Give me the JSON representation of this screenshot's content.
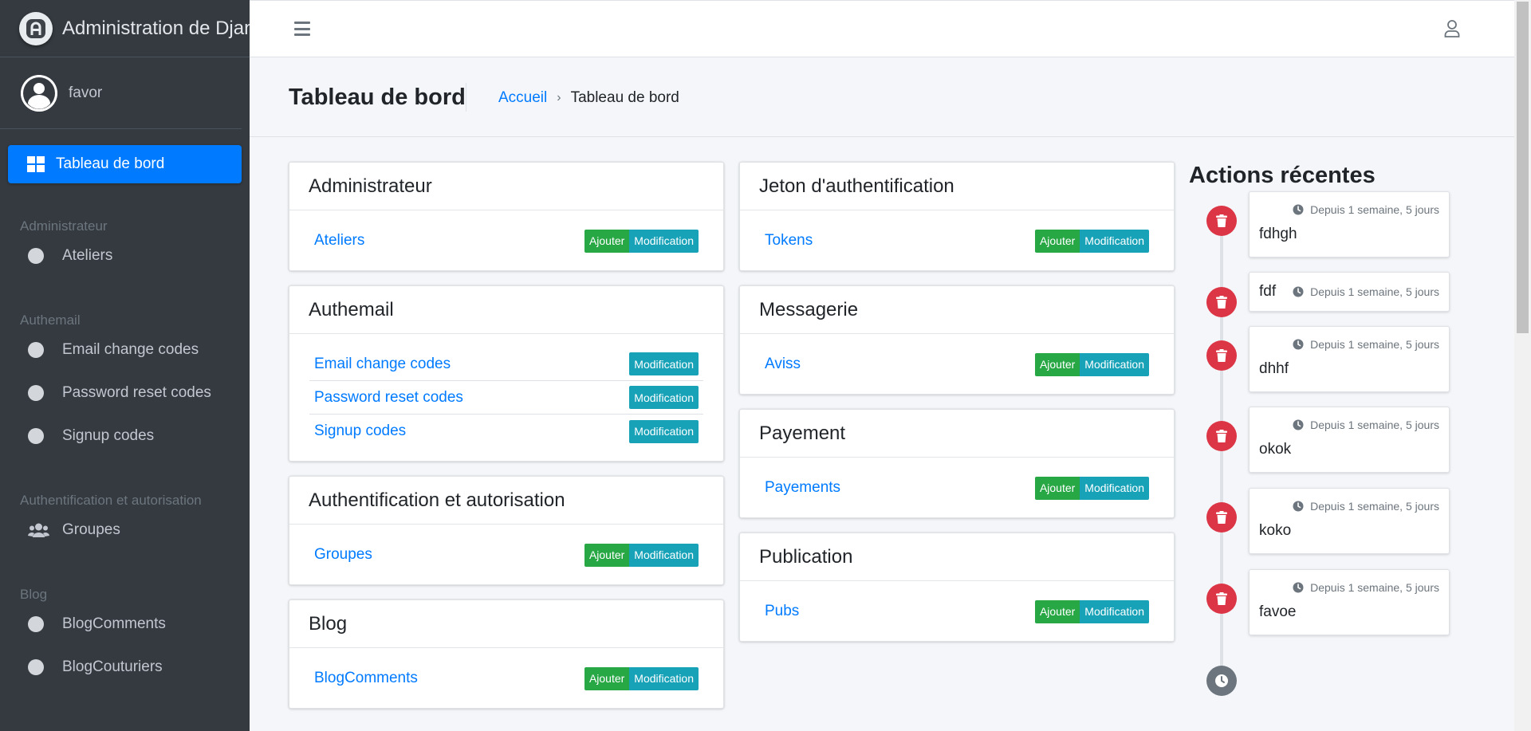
{
  "brand": {
    "title": "Administration de Django"
  },
  "user": {
    "name": "favor"
  },
  "sidebar": {
    "active": "Tableau de bord",
    "groups": [
      {
        "header": "Administrateur",
        "items": [
          "Ateliers"
        ]
      },
      {
        "header": "Authemail",
        "items": [
          "Email change codes",
          "Password reset codes",
          "Signup codes"
        ]
      },
      {
        "header": "Authentification et autorisation",
        "items": [
          "Groupes"
        ]
      },
      {
        "header": "Blog",
        "items": [
          "BlogComments",
          "BlogCouturiers"
        ]
      }
    ]
  },
  "header": {
    "title": "Tableau de bord",
    "breadcrumb_home": "Accueil",
    "breadcrumb_current": "Tableau de bord"
  },
  "labels": {
    "add": "Ajouter",
    "change": "Modification"
  },
  "apps_left": [
    {
      "name": "Administrateur",
      "models": [
        {
          "name": "Ateliers",
          "add": true
        }
      ]
    },
    {
      "name": "Authemail",
      "models": [
        {
          "name": "Email change codes",
          "add": false
        },
        {
          "name": "Password reset codes",
          "add": false
        },
        {
          "name": "Signup codes",
          "add": false
        }
      ]
    },
    {
      "name": "Authentification et autorisation",
      "models": [
        {
          "name": "Groupes",
          "add": true
        }
      ]
    },
    {
      "name": "Blog",
      "models": [
        {
          "name": "BlogComments",
          "add": true
        }
      ]
    }
  ],
  "apps_right": [
    {
      "name": "Jeton d'authentification",
      "models": [
        {
          "name": "Tokens",
          "add": true
        }
      ]
    },
    {
      "name": "Messagerie",
      "models": [
        {
          "name": "Aviss",
          "add": true
        }
      ]
    },
    {
      "name": "Payement",
      "models": [
        {
          "name": "Payements",
          "add": true
        }
      ]
    },
    {
      "name": "Publication",
      "models": [
        {
          "name": "Pubs",
          "add": true
        }
      ]
    }
  ],
  "recent": {
    "title": "Actions récentes",
    "items": [
      {
        "name": "fdhgh",
        "time": "Depuis 1 semaine, 5 jours"
      },
      {
        "name": "fdf",
        "time": "Depuis 1 semaine, 5 jours"
      },
      {
        "name": "dhhf",
        "time": "Depuis 1 semaine, 5 jours"
      },
      {
        "name": "okok",
        "time": "Depuis 1 semaine, 5 jours"
      },
      {
        "name": "koko",
        "time": "Depuis 1 semaine, 5 jours"
      },
      {
        "name": "favoe",
        "time": "Depuis 1 semaine, 5 jours"
      }
    ]
  },
  "colors": {
    "primary": "#007bff",
    "success": "#28a745",
    "info": "#17a2b8",
    "danger": "#dc3545",
    "sidebar": "#343a40"
  }
}
